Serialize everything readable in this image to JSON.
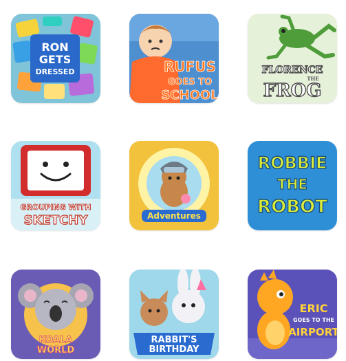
{
  "apps": [
    {
      "id": "ron-gets-dressed",
      "lines": [
        "RON",
        "GETS",
        "DRESSED"
      ],
      "icon": "clothes-pile-icon",
      "bg": "#7fc4d8"
    },
    {
      "id": "rufus-goes-to-school",
      "lines": [
        "RUFUS",
        "GOES TO",
        "SCHOOL"
      ],
      "icon": "boy-character-icon",
      "bg": "#4e8fd0"
    },
    {
      "id": "florence-the-frog",
      "lines": [
        "FLORENCE",
        "THE",
        "FROG"
      ],
      "icon": "frog-icon",
      "bg": "#e6f1da"
    },
    {
      "id": "grouping-with-sketchy",
      "lines": [
        "GROUPING WITH",
        "SKETCHY"
      ],
      "icon": "sketchy-easel-icon",
      "bg": "#aee0ef"
    },
    {
      "id": "lil-critter-adventures",
      "lines": [
        "Adventures"
      ],
      "icon": "squirrel-pilot-icon",
      "bg": "#f3c23c"
    },
    {
      "id": "robbie-the-robot",
      "lines": [
        "ROBBIE",
        "THE",
        "ROBOT"
      ],
      "icon": "robot-title-icon",
      "bg": "#2f8fd6"
    },
    {
      "id": "koala-world",
      "lines": [
        "KOALA",
        "WORLD"
      ],
      "icon": "koala-icon",
      "bg": "#6a5bb5"
    },
    {
      "id": "rabbits-birthday",
      "lines": [
        "RABBIT'S",
        "BIRTHDAY"
      ],
      "icon": "rabbit-icon",
      "bg": "#9fd8ea"
    },
    {
      "id": "eric-goes-to-the-airport",
      "lines": [
        "ERIC",
        "GOES TO THE",
        "AIRPORT"
      ],
      "icon": "dinosaur-icon",
      "bg": "#5a52b8"
    }
  ]
}
